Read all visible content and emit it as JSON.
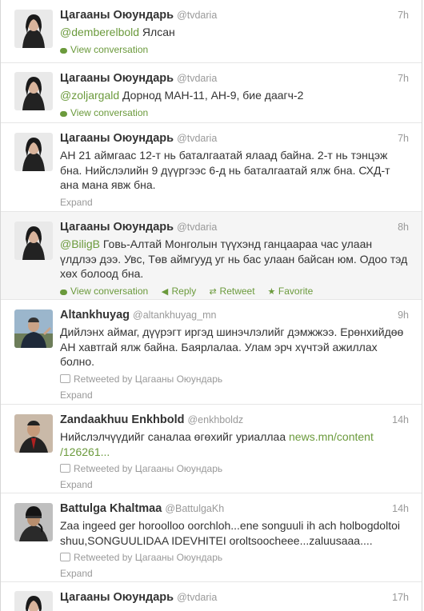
{
  "tweets": [
    {
      "fullname": "Цагааны Оюундарь",
      "username": "@tvdaria",
      "time": "7h",
      "mention": "@demberelbold",
      "text": " Ялсан",
      "action": "View conversation"
    },
    {
      "fullname": "Цагааны Оюундарь",
      "username": "@tvdaria",
      "time": "7h",
      "mention": "@zoljargald",
      "text": " Дорнод МАН-11, АН-9, бие даагч-2",
      "action": "View conversation"
    },
    {
      "fullname": "Цагааны Оюундарь",
      "username": "@tvdaria",
      "time": "7h",
      "text": "АН 21 аймгаас 12-т нь баталгаатай ялаад байна. 2-т нь тэнцэж бна. Нийслэлийн 9 дүүргээс 6-д нь баталгаатай ялж бна. СХД-т ана мана явж бна.",
      "expand": "Expand"
    },
    {
      "fullname": "Цагааны Оюундарь",
      "username": "@tvdaria",
      "time": "8h",
      "mention": "@BiligB",
      "text": " Говь-Алтай Монголын түүхэнд ганцаараа час улаан үлдлээ дээ. Увс, Төв аймгууд уг нь бас улаан байсан юм. Одоо тэд хөх болоод бна.",
      "actions": [
        "View conversation",
        "Reply",
        "Retweet",
        "Favorite"
      ]
    },
    {
      "fullname": "Altankhuyag",
      "username": "@altankhuyag_mn",
      "time": "9h",
      "text": "Дийлэнх аймаг, дүүрэгт иргэд шинэчлэлийг дэмжжээ. Ерөнхийдөө АН хавтгай ялж байна. Баярлалаа. Улам эрч хүчтэй ажиллах болно.",
      "retweeted": "Retweeted by Цагааны Оюундарь",
      "expand": "Expand"
    },
    {
      "fullname": "Zandaakhuu Enkhbold",
      "username": "@enkhboldz",
      "time": "14h",
      "text": "Нийслэлчүүдийг саналаа өгөхийг уриаллаа ",
      "link": "news.mn/content/126261...",
      "link_line1": "news.mn/content",
      "link_line2": "/126261...",
      "retweeted": "Retweeted by Цагааны Оюундарь",
      "expand": "Expand"
    },
    {
      "fullname": "Battulga Khaltmaa",
      "username": "@BattulgaKh",
      "time": "14h",
      "text": "Zaa ingeed ger horoolloo oorchloh...ene songuuli ih ach holbogdoltoi shuu,SONGUULIDAA IDEVHITEI oroltsoocheee...zaluusaaa....",
      "retweeted": "Retweeted by Цагааны Оюундарь",
      "expand": "Expand"
    },
    {
      "fullname": "Цагааны Оюундарь",
      "username": "@tvdaria",
      "time": "17h"
    }
  ],
  "colors": {
    "link": "#6b9a3c",
    "meta": "#999999",
    "hover_bg": "#f5f5f5"
  }
}
